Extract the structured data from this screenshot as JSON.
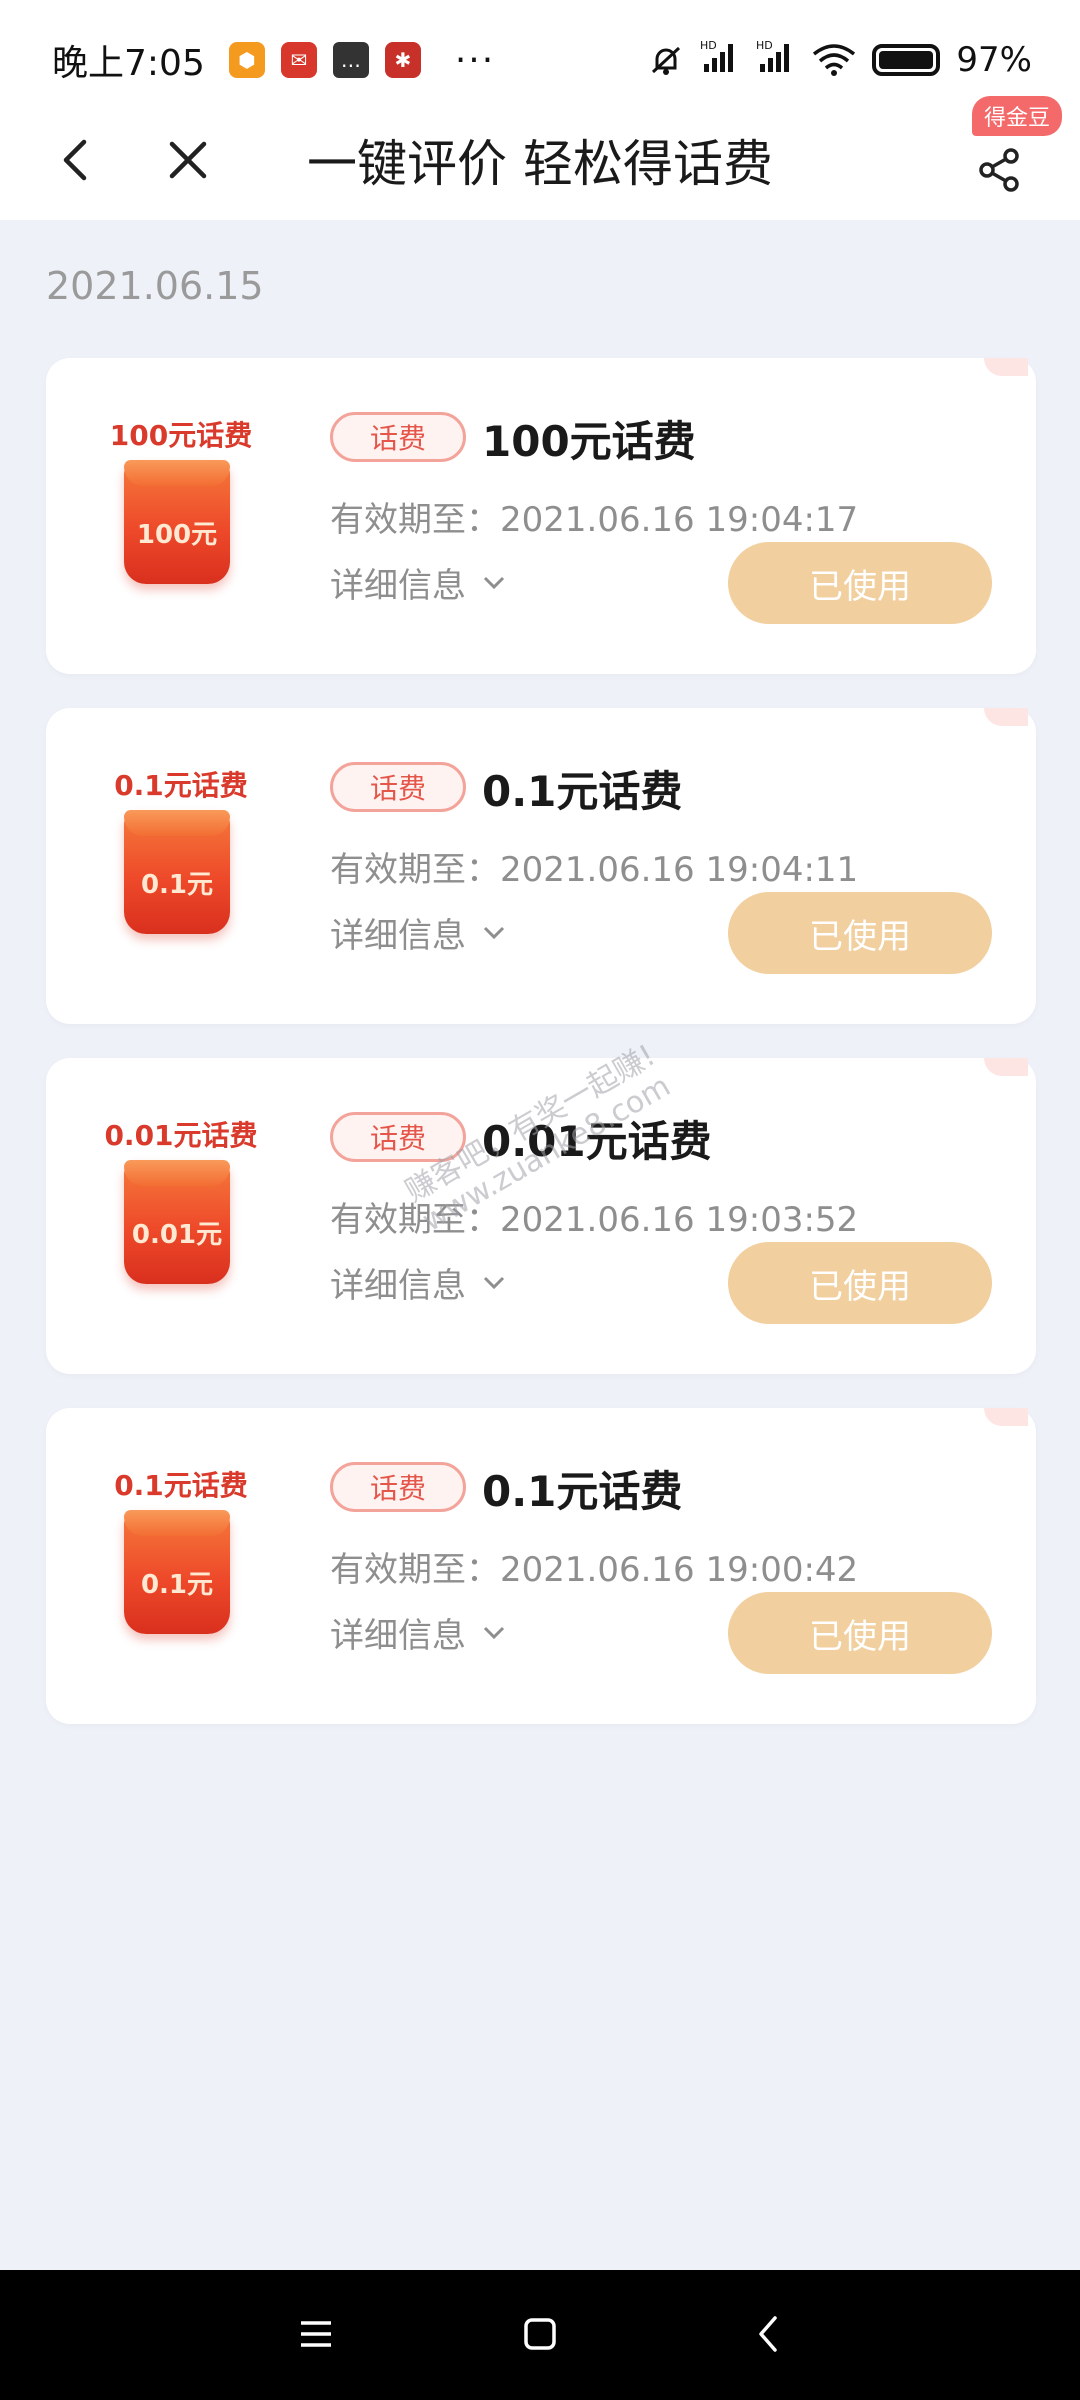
{
  "status_bar": {
    "time": "晚上7:05",
    "dots": "···",
    "signal1": "HD",
    "signal2": "HD",
    "battery_pct": "97%"
  },
  "nav": {
    "title": "一键评价 轻松得话费",
    "share_badge": "得金豆"
  },
  "date_header": "2021.06.15",
  "coupons": [
    {
      "caption": "100元话费",
      "can_label": "100元",
      "tag": "话费",
      "title": "100元话费",
      "expiry": "有效期至：2021.06.16 19:04:17",
      "details": "详细信息",
      "button": "已使用"
    },
    {
      "caption": "0.1元话费",
      "can_label": "0.1元",
      "tag": "话费",
      "title": "0.1元话费",
      "expiry": "有效期至：2021.06.16 19:04:11",
      "details": "详细信息",
      "button": "已使用"
    },
    {
      "caption": "0.01元话费",
      "can_label": "0.01元",
      "tag": "话费",
      "title": "0.01元话费",
      "expiry": "有效期至：2021.06.16 19:03:52",
      "details": "详细信息",
      "button": "已使用"
    },
    {
      "caption": "0.1元话费",
      "can_label": "0.1元",
      "tag": "话费",
      "title": "0.1元话费",
      "expiry": "有效期至：2021.06.16 19:00:42",
      "details": "详细信息",
      "button": "已使用"
    }
  ],
  "watermark": {
    "line1": "赚客吧，有奖一起赚!",
    "line2": "www.zuanke8.com"
  },
  "colors": {
    "button_bg": "#f1cf9e",
    "tag_border": "#f3a39a",
    "tag_text": "#e5564a",
    "page_bg": "#eef1f8"
  }
}
